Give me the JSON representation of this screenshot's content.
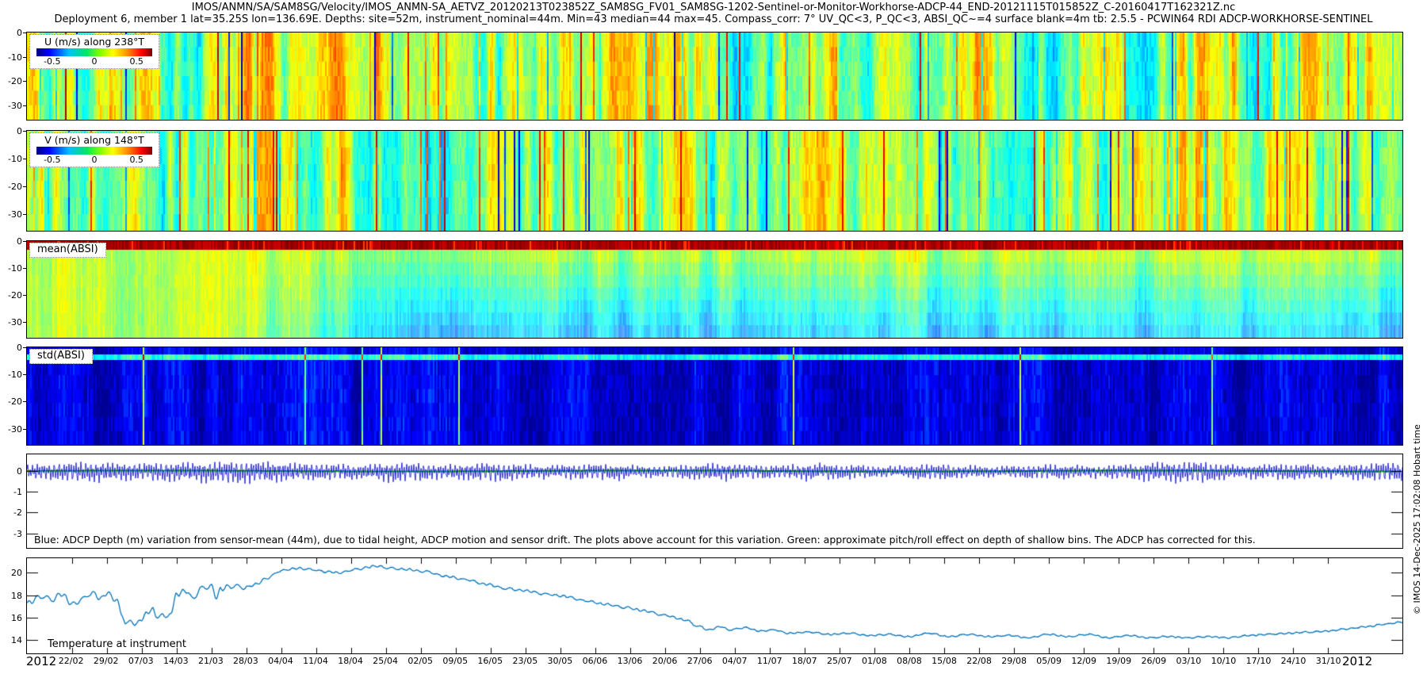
{
  "header": {
    "filename": "IMOS/ANMN/SA/SAM8SG/Velocity/IMOS_ANMN-SA_AETVZ_20120213T023852Z_SAM8SG_FV01_SAM8SG-1202-Sentinel-or-Monitor-Workhorse-ADCP-44_END-20121115T015852Z_C-20160417T162321Z.nc",
    "subtitle": "Deployment 6, member 1 lat=35.25S lon=136.69E. Depths: site=52m, instrument_nominal=44m. Min=43 median=44 max=45. Compass_corr: 7° UV_QC<3, P_QC<3, ABSI_QC~=4 surface blank=4m tb: 2.5.5 - PCWIN64 RDI ADCP-WORKHORSE-SENTINEL"
  },
  "watermark": "© IMOS 14-Dec-2025 17:02:08 Hobart time",
  "x_axis": {
    "year_left": "2012",
    "year_right": "2012",
    "first_tick_day": 9,
    "tick_interval_days": 7,
    "total_days": 276,
    "tick_labels": [
      "22/02",
      "29/02",
      "07/03",
      "14/03",
      "21/03",
      "28/03",
      "04/04",
      "11/04",
      "18/04",
      "25/04",
      "02/05",
      "09/05",
      "16/05",
      "23/05",
      "30/05",
      "06/06",
      "13/06",
      "20/06",
      "27/06",
      "04/07",
      "11/07",
      "18/07",
      "25/07",
      "01/08",
      "08/08",
      "15/08",
      "22/08",
      "29/08",
      "05/09",
      "12/09",
      "19/09",
      "26/09",
      "03/10",
      "10/10",
      "17/10",
      "24/10",
      "31/10"
    ]
  },
  "chart_data": [
    {
      "id": "u_velocity",
      "type": "heatmap",
      "legend_title": "U (m/s) along 238°T",
      "colormap": "jet",
      "clim": [
        -0.65,
        0.65
      ],
      "colorbar_ticks": [
        "-0.5",
        "0",
        "0.5"
      ],
      "yticks": [
        "0",
        "-10",
        "-20",
        "-30"
      ],
      "ylim": [
        -36,
        0
      ],
      "x_range": [
        "13/02/2012",
        "15/11/2012"
      ],
      "description": "Eastward velocity component vs depth and time; predominantly near-zero (green) with vertical tidal streaks of yellow/orange (positive) and blue/cyan (negative) spanning bins 4-36 m."
    },
    {
      "id": "v_velocity",
      "type": "heatmap",
      "legend_title": "V (m/s) along 148°T",
      "colormap": "jet",
      "clim": [
        -0.65,
        0.65
      ],
      "colorbar_ticks": [
        "-0.5",
        "0",
        "0.5"
      ],
      "yticks": [
        "0",
        "-10",
        "-20",
        "-30"
      ],
      "ylim": [
        -36,
        0
      ],
      "x_range": [
        "13/02/2012",
        "15/11/2012"
      ],
      "description": "Northward velocity component vs depth and time; mostly green (near zero) with yellow and occasional orange/blue tidal streaks."
    },
    {
      "id": "mean_absi",
      "type": "heatmap",
      "label": "mean(ABSI)",
      "colormap": "jet",
      "yticks": [
        "0",
        "-10",
        "-20",
        "-30"
      ],
      "ylim": [
        -36,
        0
      ],
      "x_range": [
        "13/02/2012",
        "15/11/2012"
      ],
      "description": "Mean acoustic backscatter: dark-red high-intensity band at the surface (0 to -3 m), green in shallow bins fading to pale cyan-blue at depth after early March."
    },
    {
      "id": "std_absi",
      "type": "heatmap",
      "label": "std(ABSI)",
      "colormap": "jet",
      "yticks": [
        "0",
        "-10",
        "-20",
        "-30"
      ],
      "ylim": [
        -36,
        0
      ],
      "x_range": [
        "13/02/2012",
        "15/11/2012"
      ],
      "description": "Backscatter standard deviation: low (dark blue) everywhere with lighter-blue vertical stripes, a thin brighter row near -3 m and rare cyan-green columns."
    },
    {
      "id": "depth_variation",
      "type": "line",
      "yticks": [
        "0",
        "-1",
        "-2",
        "-3"
      ],
      "ylim": [
        -3.7,
        0.8
      ],
      "series": [
        {
          "name": "ADCP depth (m) variation from sensor-mean (44m)",
          "color": "#0000cc"
        },
        {
          "name": "approximate pitch/roll effect on depth of shallow bins",
          "color": "#00cc00",
          "value": 0
        }
      ],
      "amplitude_profile": [
        [
          0,
          0.22
        ],
        [
          0.04,
          0.3
        ],
        [
          0.08,
          0.25
        ],
        [
          0.12,
          0.3
        ],
        [
          0.16,
          0.33
        ],
        [
          0.2,
          0.28
        ],
        [
          0.24,
          0.2
        ],
        [
          0.27,
          0.3
        ],
        [
          0.3,
          0.22
        ],
        [
          0.34,
          0.28
        ],
        [
          0.38,
          0.18
        ],
        [
          0.42,
          0.25
        ],
        [
          0.46,
          0.16
        ],
        [
          0.5,
          0.26
        ],
        [
          0.54,
          0.2
        ],
        [
          0.58,
          0.26
        ],
        [
          0.62,
          0.16
        ],
        [
          0.66,
          0.24
        ],
        [
          0.7,
          0.15
        ],
        [
          0.74,
          0.22
        ],
        [
          0.78,
          0.17
        ],
        [
          0.82,
          0.28
        ],
        [
          0.85,
          0.33
        ],
        [
          0.88,
          0.2
        ],
        [
          0.92,
          0.25
        ],
        [
          0.95,
          0.18
        ],
        [
          0.98,
          0.28
        ],
        [
          1,
          0.3
        ]
      ],
      "annotation": "Blue: ADCP Depth (m) variation from sensor-mean (44m), due to tidal height, ADCP motion and sensor drift. The plots above account for this variation. Green: approximate pitch/roll effect on depth of shallow bins. The ADCP has corrected for this."
    },
    {
      "id": "temperature",
      "type": "line",
      "label": "Temperature at instrument",
      "color": "#0072bd",
      "yticks": [
        "20",
        "18",
        "16",
        "14"
      ],
      "ylim": [
        12.8,
        21.3
      ],
      "x_range": [
        "13/02/2012",
        "15/11/2012"
      ],
      "points_frac_degC": [
        [
          0,
          17.3
        ],
        [
          0.011,
          17.9
        ],
        [
          0.018,
          17.6
        ],
        [
          0.025,
          18.1
        ],
        [
          0.033,
          17.2
        ],
        [
          0.04,
          17.6
        ],
        [
          0.047,
          18.2
        ],
        [
          0.054,
          17.7
        ],
        [
          0.058,
          18.2
        ],
        [
          0.065,
          17.6
        ],
        [
          0.069,
          16.2
        ],
        [
          0.072,
          15.6
        ],
        [
          0.08,
          15.5
        ],
        [
          0.087,
          16.3
        ],
        [
          0.091,
          16.9
        ],
        [
          0.094,
          15.9
        ],
        [
          0.098,
          16.5
        ],
        [
          0.101,
          15.8
        ],
        [
          0.105,
          16.6
        ],
        [
          0.109,
          18.1
        ],
        [
          0.116,
          18.4
        ],
        [
          0.12,
          17.7
        ],
        [
          0.127,
          18.6
        ],
        [
          0.134,
          18.8
        ],
        [
          0.138,
          17.8
        ],
        [
          0.141,
          18.6
        ],
        [
          0.149,
          18.8
        ],
        [
          0.159,
          18.7
        ],
        [
          0.167,
          19.0
        ],
        [
          0.174,
          19.5
        ],
        [
          0.185,
          20.2
        ],
        [
          0.196,
          20.4
        ],
        [
          0.207,
          20.3
        ],
        [
          0.217,
          20.1
        ],
        [
          0.228,
          20.0
        ],
        [
          0.239,
          20.3
        ],
        [
          0.254,
          20.6
        ],
        [
          0.264,
          20.4
        ],
        [
          0.275,
          20.3
        ],
        [
          0.29,
          20.1
        ],
        [
          0.304,
          19.7
        ],
        [
          0.319,
          19.4
        ],
        [
          0.333,
          19.0
        ],
        [
          0.348,
          18.6
        ],
        [
          0.362,
          18.4
        ],
        [
          0.377,
          18.1
        ],
        [
          0.391,
          17.9
        ],
        [
          0.406,
          17.5
        ],
        [
          0.42,
          17.2
        ],
        [
          0.435,
          16.9
        ],
        [
          0.449,
          16.6
        ],
        [
          0.464,
          16.2
        ],
        [
          0.478,
          15.8
        ],
        [
          0.489,
          15.2
        ],
        [
          0.496,
          14.9
        ],
        [
          0.504,
          15.2
        ],
        [
          0.511,
          14.9
        ],
        [
          0.522,
          15.1
        ],
        [
          0.533,
          14.8
        ],
        [
          0.543,
          14.9
        ],
        [
          0.554,
          14.6
        ],
        [
          0.569,
          14.7
        ],
        [
          0.583,
          14.5
        ],
        [
          0.598,
          14.6
        ],
        [
          0.612,
          14.4
        ],
        [
          0.627,
          14.5
        ],
        [
          0.641,
          14.3
        ],
        [
          0.656,
          14.6
        ],
        [
          0.67,
          14.3
        ],
        [
          0.685,
          14.5
        ],
        [
          0.699,
          14.3
        ],
        [
          0.714,
          14.4
        ],
        [
          0.728,
          14.2
        ],
        [
          0.743,
          14.5
        ],
        [
          0.757,
          14.3
        ],
        [
          0.772,
          14.5
        ],
        [
          0.786,
          14.2
        ],
        [
          0.801,
          14.4
        ],
        [
          0.815,
          14.2
        ],
        [
          0.83,
          14.3
        ],
        [
          0.844,
          14.2
        ],
        [
          0.859,
          14.3
        ],
        [
          0.873,
          14.2
        ],
        [
          0.888,
          14.4
        ],
        [
          0.902,
          14.5
        ],
        [
          0.917,
          14.6
        ],
        [
          0.931,
          14.7
        ],
        [
          0.946,
          14.8
        ],
        [
          0.96,
          15.0
        ],
        [
          0.975,
          15.2
        ],
        [
          0.986,
          15.4
        ],
        [
          1,
          15.6
        ]
      ]
    }
  ]
}
